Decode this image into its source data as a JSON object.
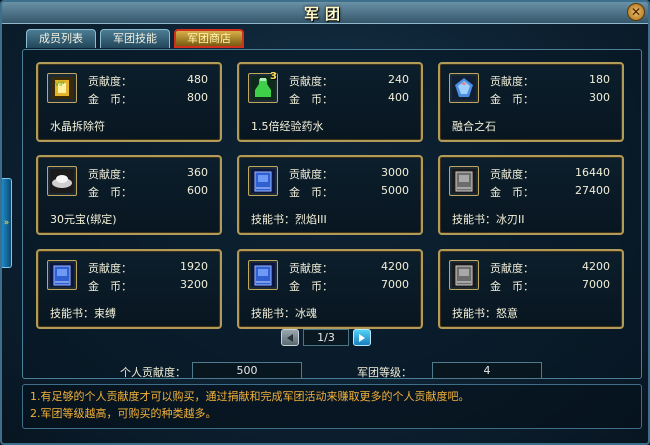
{
  "window": {
    "title": "军团",
    "close_glyph": "✕"
  },
  "tabs": [
    {
      "label": "成员列表",
      "active": false
    },
    {
      "label": "军团技能",
      "active": false
    },
    {
      "label": "军团商店",
      "active": true
    }
  ],
  "shop": {
    "contribution_label": "贡献度：",
    "gold_label": "金　币：",
    "items": [
      {
        "name": "水晶拆除符",
        "contribution": "480",
        "gold": "800",
        "icon": "crystal-charm-icon"
      },
      {
        "name": "1.5倍经验药水",
        "contribution": "240",
        "gold": "400",
        "icon": "exp-potion-icon",
        "badge": "3"
      },
      {
        "name": "融合之石",
        "contribution": "180",
        "gold": "300",
        "icon": "fusion-stone-icon"
      },
      {
        "name": "30元宝(绑定)",
        "contribution": "360",
        "gold": "600",
        "icon": "ingot-icon"
      },
      {
        "name": "技能书：烈焰III",
        "contribution": "3000",
        "gold": "5000",
        "icon": "skill-book-blue-icon"
      },
      {
        "name": "技能书：冰刃II",
        "contribution": "16440",
        "gold": "27400",
        "icon": "skill-book-gray-icon"
      },
      {
        "name": "技能书：束缚",
        "contribution": "1920",
        "gold": "3200",
        "icon": "skill-book-blue-icon"
      },
      {
        "name": "技能书：冰魂",
        "contribution": "4200",
        "gold": "7000",
        "icon": "skill-book-blue-icon"
      },
      {
        "name": "技能书：怒意",
        "contribution": "4200",
        "gold": "7000",
        "icon": "skill-book-gray-icon"
      }
    ]
  },
  "pager": {
    "current": "1/3"
  },
  "footer": {
    "personal_label": "个人贡献度：",
    "personal_value": "500",
    "level_label": "军团等级：",
    "level_value": "4",
    "notes": [
      "1.有足够的个人贡献度才可以购买，通过捐献和完成军团活动来赚取更多的个人贡献度吧。",
      "2.军团等级越高，可购买的种类越多。"
    ]
  }
}
